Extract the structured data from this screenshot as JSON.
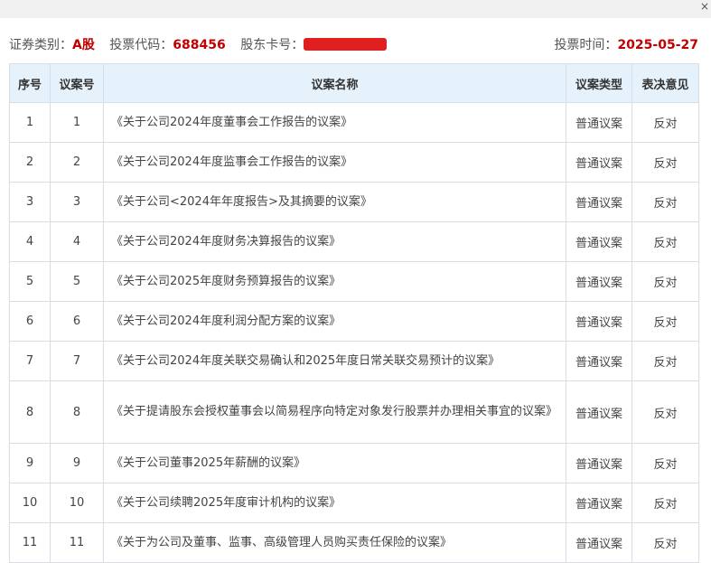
{
  "info": {
    "security_type_label": "证券类别：",
    "security_type_value": "A股",
    "vote_code_label": "投票代码：",
    "vote_code_value": "688456",
    "shareholder_card_label": "股东卡号：",
    "vote_time_label": "投票时间：",
    "vote_time_value": "2025-05-27"
  },
  "close_label": "×",
  "table": {
    "headers": [
      "序号",
      "议案号",
      "议案名称",
      "议案类型",
      "表决意见"
    ],
    "rows": [
      {
        "seq": "1",
        "no": "1",
        "name": "《关于公司2024年度董事会工作报告的议案》",
        "type": "普通议案",
        "opinion": "反对"
      },
      {
        "seq": "2",
        "no": "2",
        "name": "《关于公司2024年度监事会工作报告的议案》",
        "type": "普通议案",
        "opinion": "反对"
      },
      {
        "seq": "3",
        "no": "3",
        "name": "《关于公司<2024年年度报告>及其摘要的议案》",
        "type": "普通议案",
        "opinion": "反对"
      },
      {
        "seq": "4",
        "no": "4",
        "name": "《关于公司2024年度财务决算报告的议案》",
        "type": "普通议案",
        "opinion": "反对"
      },
      {
        "seq": "5",
        "no": "5",
        "name": "《关于公司2025年度财务预算报告的议案》",
        "type": "普通议案",
        "opinion": "反对"
      },
      {
        "seq": "6",
        "no": "6",
        "name": "《关于公司2024年度利润分配方案的议案》",
        "type": "普通议案",
        "opinion": "反对"
      },
      {
        "seq": "7",
        "no": "7",
        "name": "《关于公司2024年度关联交易确认和2025年度日常关联交易预计的议案》",
        "type": "普通议案",
        "opinion": "反对"
      },
      {
        "seq": "8",
        "no": "8",
        "name": "《关于提请股东会授权董事会以简易程序向特定对象发行股票并办理相关事宜的议案》",
        "type": "普通议案",
        "opinion": "反对"
      },
      {
        "seq": "9",
        "no": "9",
        "name": "《关于公司董事2025年薪酬的议案》",
        "type": "普通议案",
        "opinion": "反对"
      },
      {
        "seq": "10",
        "no": "10",
        "name": "《关于公司续聘2025年度审计机构的议案》",
        "type": "普通议案",
        "opinion": "反对"
      },
      {
        "seq": "11",
        "no": "11",
        "name": "《关于为公司及董事、监事、高级管理人员购买责任保险的议案》",
        "type": "普通议案",
        "opinion": "反对"
      }
    ]
  }
}
